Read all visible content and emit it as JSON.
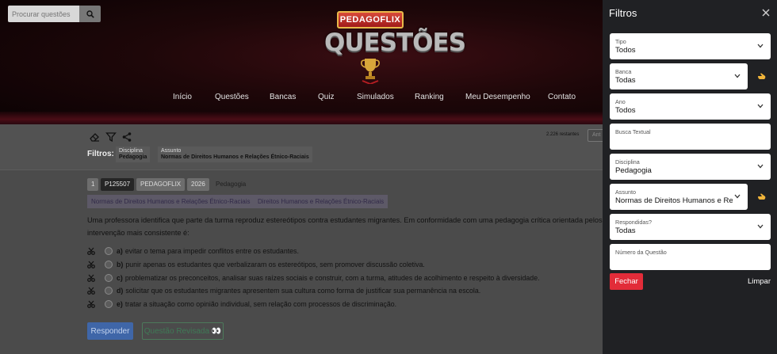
{
  "search": {
    "placeholder": "Procurar questões"
  },
  "logo": {
    "top": "PEDAGOFLIX",
    "main": "QUESTÕES"
  },
  "nav": [
    "Início",
    "Questões",
    "Bancas",
    "Quiz",
    "Simulados",
    "Ranking",
    "Meu Desempenho",
    "Contato"
  ],
  "toolbar": {
    "remaining": "2.226 restantes",
    "stub": "Ant"
  },
  "filters": {
    "label": "Filtros:",
    "chips": [
      {
        "key": "Disciplina",
        "value": "Pedagogia"
      },
      {
        "key": "Assunto",
        "value": "Normas de Direitos Humanos e Relações Étnico-Raciais"
      }
    ]
  },
  "question": {
    "number": "1",
    "id": "P125507",
    "source": "PEDAGOFLIX",
    "year": "2026",
    "discipline": "Pedagogia",
    "subjects": [
      "Normas de Direitos Humanos e Relações Étnico-Raciais",
      "Direitos Humanos e Relações Étnico-Raciais"
    ],
    "text_line1": "Uma professora identifica que parte da turma reproduz estereótipos contra estudantes migrantes. Em conformidade com uma pedagogia crítica orientada pelos di",
    "text_line2": "intervenção mais consistente é:",
    "options": [
      {
        "letter": "a)",
        "text": "evitar o tema para impedir conflitos entre os estudantes."
      },
      {
        "letter": "b)",
        "text": "punir apenas os estudantes que verbalizaram os estereótipos, sem promover discussão coletiva."
      },
      {
        "letter": "c)",
        "text": "problematizar os preconceitos, analisar suas raízes sociais e construir, com a turma, atitudes de acolhimento e respeito à diversidade."
      },
      {
        "letter": "d)",
        "text": "solicitar que os estudantes migrantes apresentem sua cultura como forma de justificar sua permanência na escola."
      },
      {
        "letter": "e)",
        "text": "tratar a situação como opinião individual, sem relação com processos de discriminação."
      }
    ],
    "answer_button": "Responder",
    "reviewed_button": "Questão Revisada 👀"
  },
  "sidebar": {
    "title": "Filtros",
    "fields": [
      {
        "label": "Tipo",
        "value": "Todos"
      },
      {
        "label": "Banca",
        "value": "Todas"
      },
      {
        "label": "Ano",
        "value": "Todos"
      },
      {
        "label": "Busca Textual",
        "value": ""
      },
      {
        "label": "Disciplina",
        "value": "Pedagogia"
      },
      {
        "label": "Assunto",
        "value": "Normas de Direitos Humanos e Relações Étnico-Raciais"
      },
      {
        "label": "Respondidas?",
        "value": "Todas"
      },
      {
        "label": "Número da Questão",
        "value": ""
      }
    ],
    "close_button": "Fechar",
    "clear_button": "Limpar"
  },
  "colors": {
    "accent_red": "#e22c39",
    "sidebar_bg": "#202124",
    "overlay": "#4b4b4b"
  }
}
